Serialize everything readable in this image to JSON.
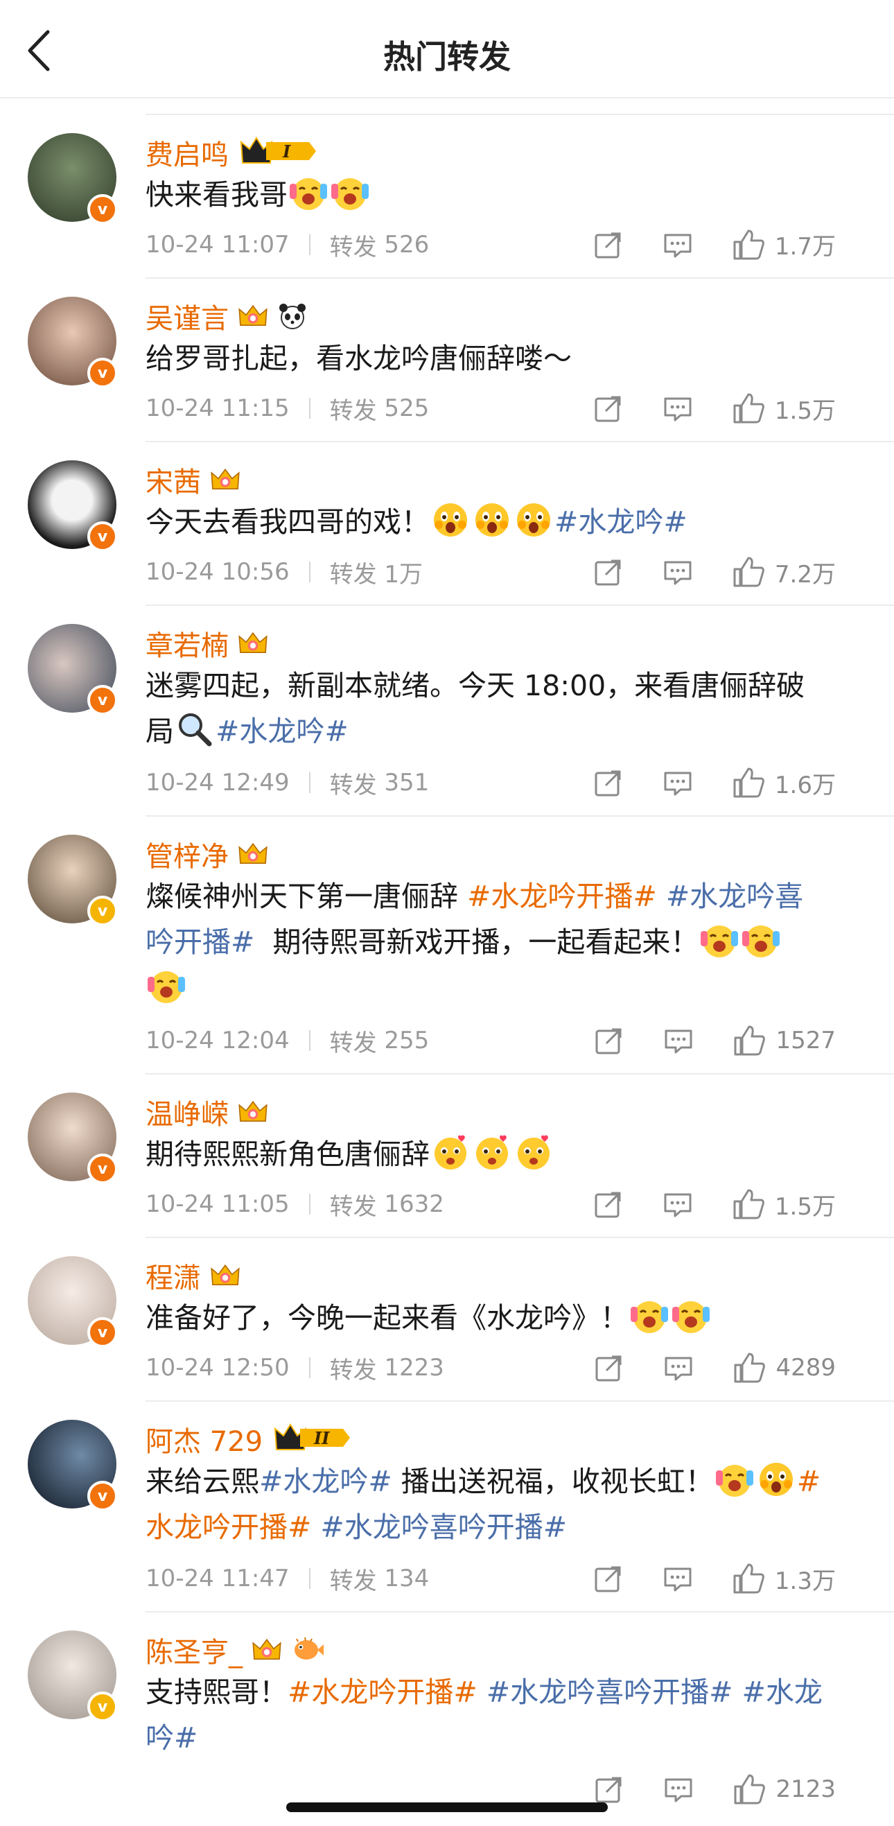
{
  "header": {
    "title": "热门转发"
  },
  "posts": [
    {
      "name": "费启鸣",
      "badge": "I",
      "text": "快来看我哥",
      "emojis": 2,
      "time": "10-24 11:07",
      "repost_label": "转发",
      "reposts": "526",
      "likes": "1.7万",
      "verified": "orange"
    },
    {
      "name": "吴谨言",
      "text": "给罗哥扎起，看水龙吟唐俪辞喽～",
      "time": "10-24 11:15",
      "repost_label": "转发",
      "reposts": "525",
      "likes": "1.5万",
      "verified": "orange"
    },
    {
      "name": "宋茜",
      "text_before": "今天去看我四哥的戏！",
      "tag": "#水龙吟#",
      "time": "10-24 10:56",
      "repost_label": "转发",
      "reposts": "1万",
      "likes": "7.2万",
      "verified": "orange"
    },
    {
      "name": "章若楠",
      "text_line1": "迷雾四起，新副本就绪。今天 18:00，来看唐俪辞破",
      "text_line2": "局",
      "tag": "#水龙吟#",
      "time": "10-24 12:49",
      "repost_label": "转发",
      "reposts": "351",
      "likes": "1.6万",
      "verified": "orange"
    },
    {
      "name": "管梓净",
      "text_before": "燦候神州天下第一唐俪辞",
      "tag1": "#水龙吟开播#",
      "tag2a": "#水龙吟喜",
      "tag2b": "吟开播#",
      "text_after": "期待熙哥新戏开播，一起看起来！",
      "time": "10-24 12:04",
      "repost_label": "转发",
      "reposts": "255",
      "likes": "1527",
      "verified": "gold"
    },
    {
      "name": "温峥嵘",
      "text": "期待熙熙新角色唐俪辞",
      "time": "10-24 11:05",
      "repost_label": "转发",
      "reposts": "1632",
      "likes": "1.5万",
      "verified": "orange"
    },
    {
      "name": "程潇",
      "text": "准备好了，今晚一起来看《水龙吟》！",
      "time": "10-24 12:50",
      "repost_label": "转发",
      "reposts": "1223",
      "likes": "4289",
      "verified": "orange"
    },
    {
      "name": "阿杰 729",
      "badge": "II",
      "text_before": "来给云熙",
      "tag": "#水龙吟#",
      "text_mid": "播出送祝福，收视长虹！",
      "tag_hash": "#",
      "tag_line2a": "水龙吟开播#",
      "tag_line2b": "#水龙吟喜吟开播#",
      "time": "10-24 11:47",
      "repost_label": "转发",
      "reposts": "134",
      "likes": "1.3万",
      "verified": "orange"
    },
    {
      "name": "陈圣亨_",
      "text_before": "支持熙哥！",
      "tag1": "#水龙吟开播#",
      "tag2": "#水龙吟喜吟开播#",
      "tag3a": "#水龙",
      "tag3b": "吟#",
      "likes": "2123",
      "verified": "gold"
    }
  ],
  "colors": {
    "name": "#e86a00",
    "topic": "#4a6ea9",
    "meta": "#9a9a9a"
  }
}
